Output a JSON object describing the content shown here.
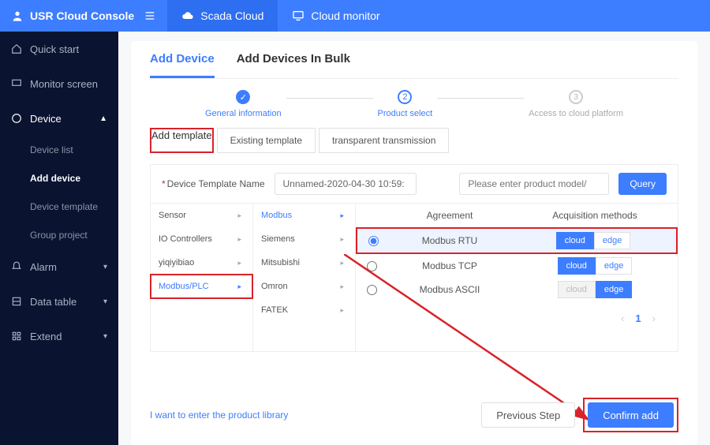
{
  "topbar": {
    "brand": "USR Cloud Console",
    "tab1": "Scada Cloud",
    "tab2": "Cloud monitor"
  },
  "sidebar": {
    "quick": "Quick start",
    "monitor": "Monitor screen",
    "device": "Device",
    "device_sub": [
      "Device list",
      "Add device",
      "Device template",
      "Group project"
    ],
    "alarm": "Alarm",
    "datatable": "Data table",
    "extend": "Extend"
  },
  "pagetabs": {
    "add": "Add Device",
    "bulk": "Add Devices In Bulk"
  },
  "steps": {
    "s1": "General information",
    "s2": "Product select",
    "s3": "Access to cloud platform"
  },
  "templateTabs": {
    "add": "Add template",
    "existing": "Existing template",
    "transparent": "transparent transmission"
  },
  "nameRow": {
    "label": "Device Template Name",
    "value": "Unnamed-2020-04-30 10:59:",
    "search_ph": "Please enter product model/",
    "query": "Query"
  },
  "cascade": {
    "col1": [
      "Sensor",
      "IO Controllers",
      "yiqiyibiao",
      "Modbus/PLC"
    ],
    "col2": [
      "Modbus",
      "Siemens",
      "Mitsubishi",
      "Omron",
      "FATEK"
    ],
    "header": {
      "agreement": "Agreement",
      "methods": "Acquisition methods"
    },
    "rows": [
      {
        "name": "Modbus RTU",
        "cloud": "cloud",
        "edge": "edge",
        "cloudOn": true,
        "edgeOn": false,
        "checked": true,
        "marked": true
      },
      {
        "name": "Modbus TCP",
        "cloud": "cloud",
        "edge": "edge",
        "cloudOn": true,
        "edgeOn": false,
        "checked": false,
        "marked": false
      },
      {
        "name": "Modbus ASCII",
        "cloud": "cloud",
        "edge": "edge",
        "cloudOn": false,
        "edgeOn": true,
        "greyCloud": true,
        "checked": false,
        "marked": false
      }
    ]
  },
  "pager": {
    "page": "1"
  },
  "footer": {
    "link": "I want to enter the product library",
    "prev": "Previous Step",
    "confirm": "Confirm add"
  }
}
